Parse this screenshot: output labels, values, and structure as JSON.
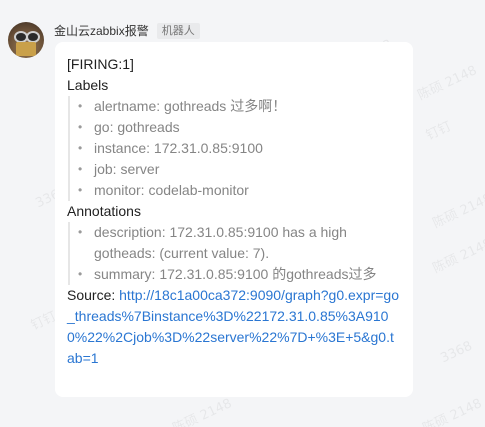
{
  "sender": {
    "name": "金山云zabbix报警",
    "tag": "机器人",
    "avatar_icon": "robot-avatar-icon"
  },
  "watermarks": [
    "陈硕 2148",
    "钉钉",
    "陈硕 2148",
    "陈硕 2148",
    "陈硕 2148",
    "3368",
    "陈硕 2148",
    "陈硕 2148",
    "钉钉",
    "3368"
  ],
  "message": {
    "firing": "[FIRING:1]",
    "labels_heading": "Labels",
    "labels": [
      "alertname: gothreads 过多啊！",
      "go: gothreads",
      "instance: 172.31.0.85:9100",
      "job: server",
      "monitor: codelab-monitor"
    ],
    "annotations_heading": "Annotations",
    "annotations": [
      "description: 172.31.0.85:9100 has a high gotheads: (current value: 7).",
      "summary: 172.31.0.85:9100 的gothreads过多"
    ],
    "source_label": "Source: ",
    "source_url": "http://18c1a00ca372:9090/graph?g0.expr=go_threads%7Binstance%3D%22172.31.0.85%3A9100%22%2Cjob%3D%22server%22%7D+%3E+5&g0.tab=1"
  },
  "colors": {
    "page_bg": "#f4f5f7",
    "bubble_bg": "#ffffff",
    "link": "#2a76d2",
    "list_text": "#858585"
  }
}
